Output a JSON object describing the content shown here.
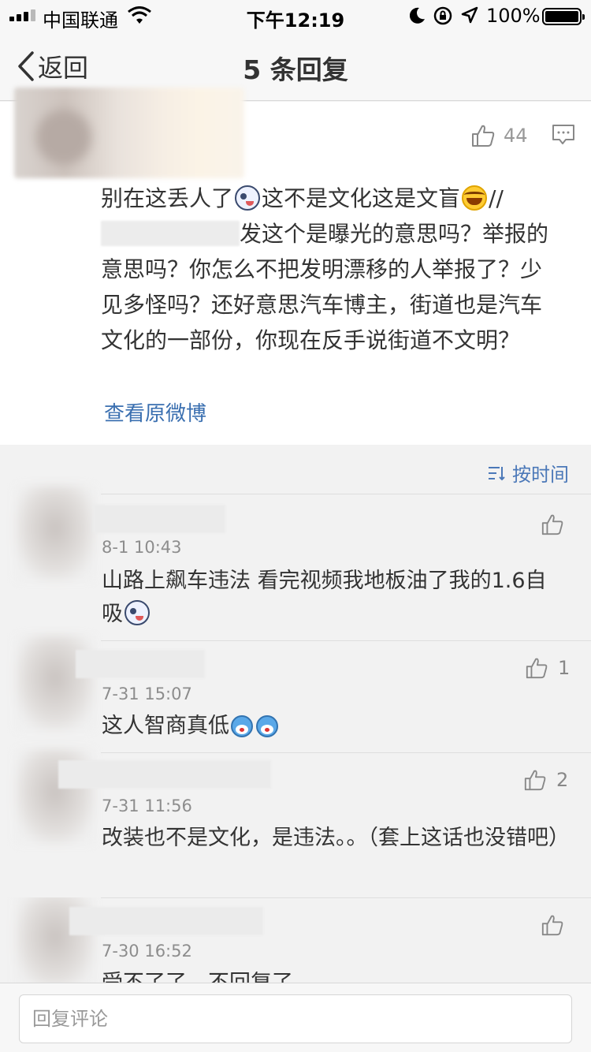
{
  "status_bar": {
    "carrier": "中国联通",
    "time": "下午12:19",
    "battery": "100%"
  },
  "nav": {
    "back_label": "返回",
    "title": "5 条回复"
  },
  "main_comment": {
    "like_count": "44",
    "text_part1": "别在这丢人了",
    "text_part2": "这不是文化这是文盲",
    "text_part3": "//",
    "text_part4": "发这个是曝光的意思吗？举报的意思吗？你怎么不把发明漂移的人举报了？少见多怪吗？还好意思汽车博主，街道也是汽车文化的一部份，你现在反手说街道不文明？",
    "view_original": "查看原微博"
  },
  "sort": {
    "label": "按时间"
  },
  "replies": [
    {
      "time": "8-1 10:43",
      "text": "山路上飙车违法 看完视频我地板油了我的1.6自吸",
      "likes": ""
    },
    {
      "time": "7-31 15:07",
      "text": "这人智商真低",
      "likes": "1"
    },
    {
      "time": "7-31 11:56",
      "text": "改装也不是文化，是违法。。（套上这话也没错吧）",
      "likes": "2"
    },
    {
      "time": "7-30 16:52",
      "text": "受不了了，不回复了",
      "likes": ""
    }
  ],
  "footer": {
    "placeholder": "回复评论"
  },
  "colors": {
    "link": "#3a6fb0",
    "sort": "#4b78b8",
    "meta": "#8d8d8d"
  }
}
